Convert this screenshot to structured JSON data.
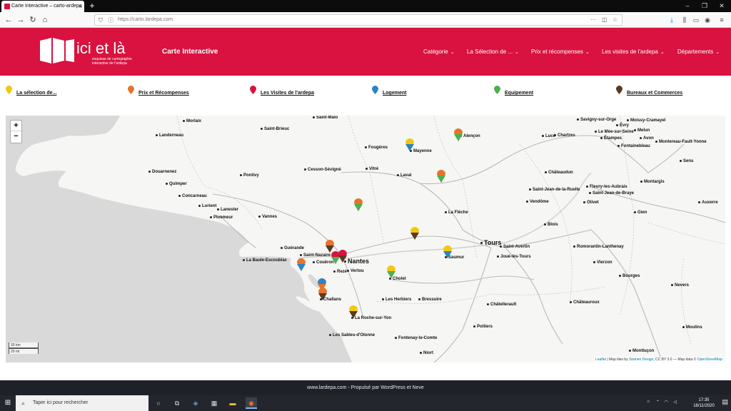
{
  "browser": {
    "tab_title": "Carte Interactive – carto-ardepa",
    "tab_close": "×",
    "new_tab": "+",
    "url": "https://carto.lardepa.com",
    "window_controls": [
      "–",
      "❐",
      "✕"
    ]
  },
  "site": {
    "logo_text": "ici et là",
    "logo_sub": "esquisse de cartographie interactive de l'ardepa",
    "title": "Carte Interactive",
    "menu": [
      {
        "label": "Catégorie"
      },
      {
        "label": "La Sélection de ..."
      },
      {
        "label": "Prix et récompenses"
      },
      {
        "label": "Les visites de l'ardepa"
      },
      {
        "label": "Départements"
      }
    ],
    "brand_color": "#d9123f"
  },
  "legend": [
    {
      "label": "La sélection de...",
      "color": "#f2c70f"
    },
    {
      "label": "Prix et Récompenses",
      "color": "#e8722a"
    },
    {
      "label": "Les Visites de l'ardepa",
      "color": "#d9123f"
    },
    {
      "label": "Logement",
      "color": "#2a84c6"
    },
    {
      "label": "Equipement",
      "color": "#4caf50"
    },
    {
      "label": "Bureaux et Commerces",
      "color": "#5a3a22"
    }
  ],
  "map": {
    "zoom_in": "+",
    "zoom_out": "−",
    "scale_km": "30 km",
    "scale_mi": "20 mi",
    "attribution_leaflet": "Leaflet",
    "attribution_rest": " | Map tiles by ",
    "attribution_stamen": "Stamen Design",
    "attribution_cc": ", CC BY 3.0",
    "attribution_osm_pre": " — Map data © ",
    "attribution_osm": "OpenStreetMap",
    "cities": [
      "Morlaix",
      "Saint-Malo",
      "Saint-Brieuc",
      "Landerneau",
      "Fougères",
      "Mayenne",
      "Douarnenez",
      "Quimper",
      "Pontivy",
      "Cesson-Sévigné",
      "Vitré",
      "Laval",
      "Concarneau",
      "Lorient",
      "Lanester",
      "Ploemeur",
      "Vannes",
      "La Flèche",
      "Guérande",
      "Saint-Nazaire",
      "Nantes",
      "Couëron",
      "La Baule-Escoublac",
      "Rezé",
      "Vertou",
      "Tours",
      "Saint-Avertin",
      "Joué-lès-Tours",
      "Saumur",
      "Cholet",
      "Challans",
      "Les Herbiers",
      "Bressuire",
      "La Roche-sur-Yon",
      "Les Sables-d'Olonne",
      "Fontenay-le-Comte",
      "Niort",
      "Châtellerault",
      "Poitiers",
      "Alençon",
      "Lucé",
      "Chartres",
      "Savigny-sur-Orge",
      "Évry",
      "Moissy-Cramayel",
      "Le Mée-sur-Seine",
      "Melun",
      "Étampes",
      "Avon",
      "Fontainebleau",
      "Montereau-Fault-Yonne",
      "Sens",
      "Châteaudun",
      "Fleury-les-Aubrais",
      "Saint-Jean-de-la-Ruelle",
      "Saint-Jean-de-Braye",
      "Olivet",
      "Montargis",
      "Vendôme",
      "Blois",
      "Gien",
      "Auxerre",
      "Romorantin-Lanthenay",
      "Vierzon",
      "Bourges",
      "Nevers",
      "Châteauroux",
      "Moulins",
      "Montluçon"
    ]
  },
  "footer": {
    "text": "www.lardepa.com - Propulsé par WordPress et Neve"
  },
  "taskbar": {
    "search_placeholder": "Taper ici pour rechercher",
    "time": "17:35",
    "date": "18/11/2020"
  }
}
